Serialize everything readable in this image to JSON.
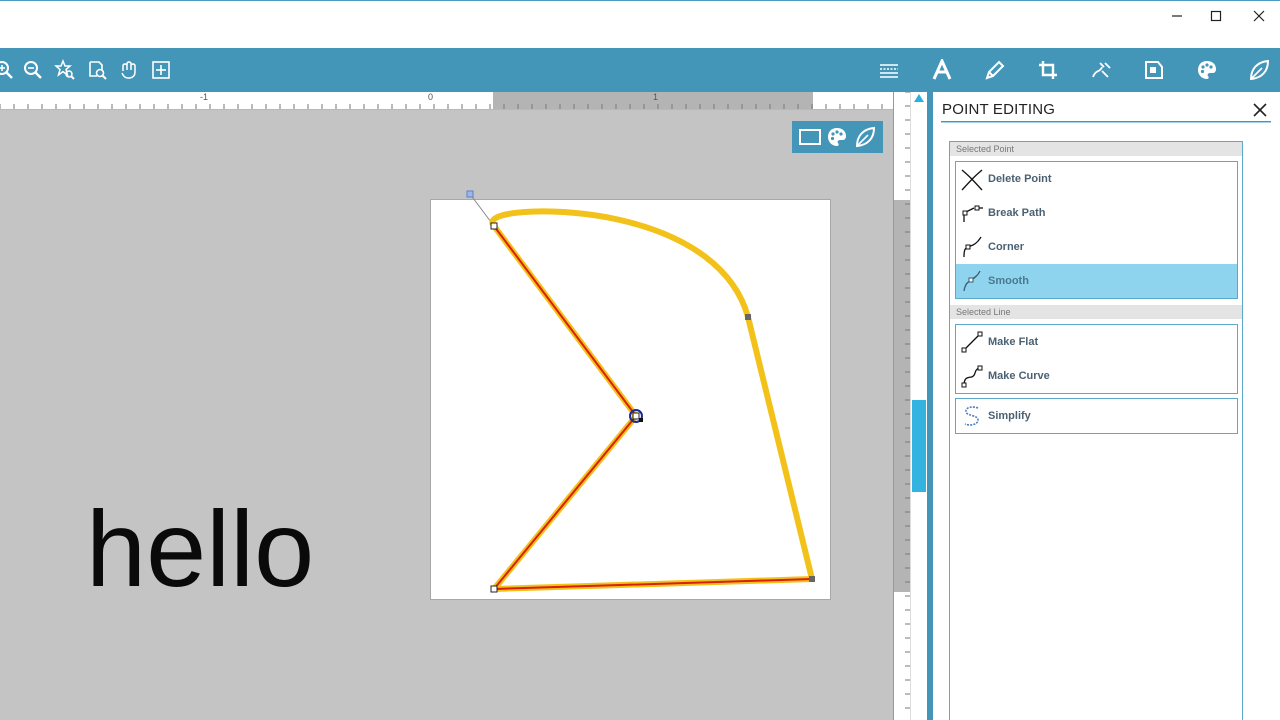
{
  "ruler": {
    "marks": [
      "-1",
      "0",
      "1"
    ]
  },
  "canvas": {
    "text": "hello"
  },
  "panel": {
    "title": "POINT EDITING",
    "selected_point": {
      "label": "Selected Point",
      "buttons": [
        "Delete Point",
        "Break Path",
        "Corner",
        "Smooth"
      ],
      "active": "Smooth"
    },
    "selected_line": {
      "label": "Selected Line",
      "buttons": [
        "Make Flat",
        "Make Curve"
      ]
    },
    "simplify": "Simplify"
  },
  "colors": {
    "accent": "#4496b9",
    "active": "#8fd4ee",
    "shape_outline": "#f3c21a",
    "selected_segment": "#d8200c",
    "canvas_bg": "#c4c4c4"
  }
}
